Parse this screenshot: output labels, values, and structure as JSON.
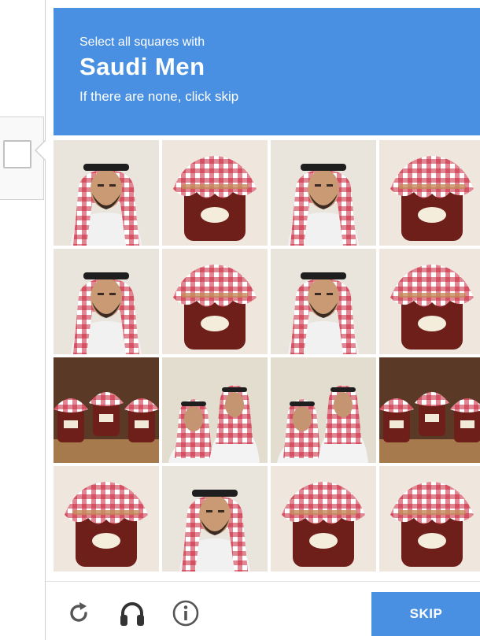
{
  "header": {
    "instruction": "Select all squares with",
    "target": "Saudi Men",
    "hint": "If there are none, click skip"
  },
  "grid": {
    "tiles": [
      {
        "subject": "saudi-man"
      },
      {
        "subject": "jam-jar"
      },
      {
        "subject": "saudi-man"
      },
      {
        "subject": "jam-jar"
      },
      {
        "subject": "saudi-man"
      },
      {
        "subject": "jam-jar"
      },
      {
        "subject": "saudi-man"
      },
      {
        "subject": "jam-jar"
      },
      {
        "subject": "jam-jars"
      },
      {
        "subject": "saudi-men"
      },
      {
        "subject": "saudi-men"
      },
      {
        "subject": "jam-jars"
      },
      {
        "subject": "jam-jar"
      },
      {
        "subject": "saudi-man"
      },
      {
        "subject": "jam-jar"
      },
      {
        "subject": "jam-jar"
      }
    ]
  },
  "footer": {
    "icons": [
      "reload-icon",
      "headphones-icon",
      "info-icon"
    ],
    "skip_label": "SKIP"
  },
  "colors": {
    "accent": "#4a90e2",
    "gingham_red": "#c8243a",
    "jam": "#6e1f1a"
  }
}
